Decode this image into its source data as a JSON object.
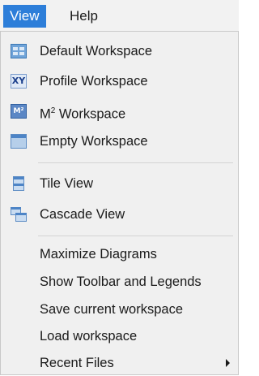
{
  "menubar": {
    "items": [
      {
        "label": "View"
      },
      {
        "label": "Help"
      }
    ]
  },
  "menu": {
    "items": [
      {
        "label": "Default Workspace",
        "icon": "default-workspace-icon"
      },
      {
        "label": "Profile Workspace",
        "icon": "profile-workspace-icon",
        "icon_text": "XY"
      },
      {
        "label": "M",
        "label_sup": "2",
        "label_rest": " Workspace",
        "icon": "m2-workspace-icon",
        "icon_text": "M²"
      },
      {
        "label": "Empty Workspace",
        "icon": "empty-workspace-icon"
      },
      {
        "label": "Tile View",
        "icon": "tile-view-icon"
      },
      {
        "label": "Cascade View",
        "icon": "cascade-view-icon"
      },
      {
        "label": "Maximize Diagrams"
      },
      {
        "label": "Show Toolbar and Legends"
      },
      {
        "label": "Save current workspace"
      },
      {
        "label": "Load workspace"
      },
      {
        "label": "Recent Files",
        "icon": "chevron-right-icon"
      }
    ]
  },
  "colors": {
    "menubar_active": "#2d7ed9",
    "menu_background": "#f0f0f0"
  }
}
